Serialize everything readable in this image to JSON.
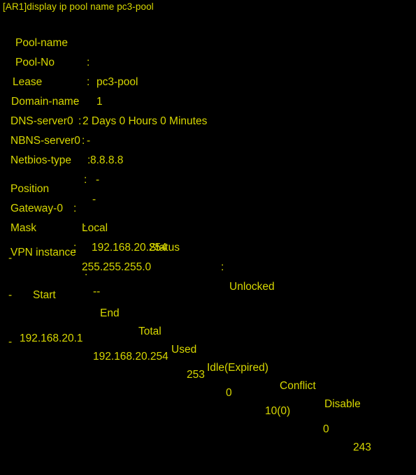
{
  "terminal": {
    "background_color": "#000000",
    "text_color": "#d7d700",
    "prompt_line": "[AR1]display ip pool name pc3-pool"
  },
  "pool_info": {
    "rows": [
      {
        "label": "Pool-name",
        "separator": ":",
        "value": "pc3-pool"
      },
      {
        "label": "Pool-No",
        "separator": ":",
        "value": "1"
      },
      {
        "label": "Lease",
        "separator": ":",
        "value": "2 Days 0 Hours 0 Minutes"
      },
      {
        "label": "Domain-name",
        "separator": ":",
        "value": "-"
      },
      {
        "label": "DNS-server0",
        "separator": ":",
        "value": "8.8.8.8"
      },
      {
        "label": "NBNS-server0",
        "separator": ":",
        "value": "-"
      },
      {
        "label": "Netbios-type",
        "separator": ":",
        "value": "-"
      },
      {
        "label": "Position",
        "separator": ":",
        "value": "Local"
      },
      {
        "label": "Gateway-0",
        "separator": ":",
        "value": "192.168.20.254"
      },
      {
        "label": "Mask",
        "separator": ":",
        "value": "255.255.255.0"
      },
      {
        "label": "VPN instance",
        "separator": ":",
        "value": "--"
      }
    ],
    "status_label": "Status",
    "status_separator": ":",
    "status_value": "Unlocked"
  },
  "separators": {
    "dash_char": "-",
    "top_rule": "--------------------------------------------------------------------------------",
    "mid_rule": "--------------------------------------------------------------------------------",
    "bottom_rule": "--------------------------------------------------------------------------------"
  },
  "address_table": {
    "headers": [
      "Start",
      "End",
      "Total",
      "Used",
      "Idle(Expired)",
      "Conflict",
      "Disable"
    ],
    "rows": [
      {
        "start": "192.168.20.1",
        "end": "192.168.20.254",
        "total": "253",
        "used": "0",
        "idle_expired": "10(0)",
        "conflict": "0",
        "disable": "243"
      }
    ]
  }
}
